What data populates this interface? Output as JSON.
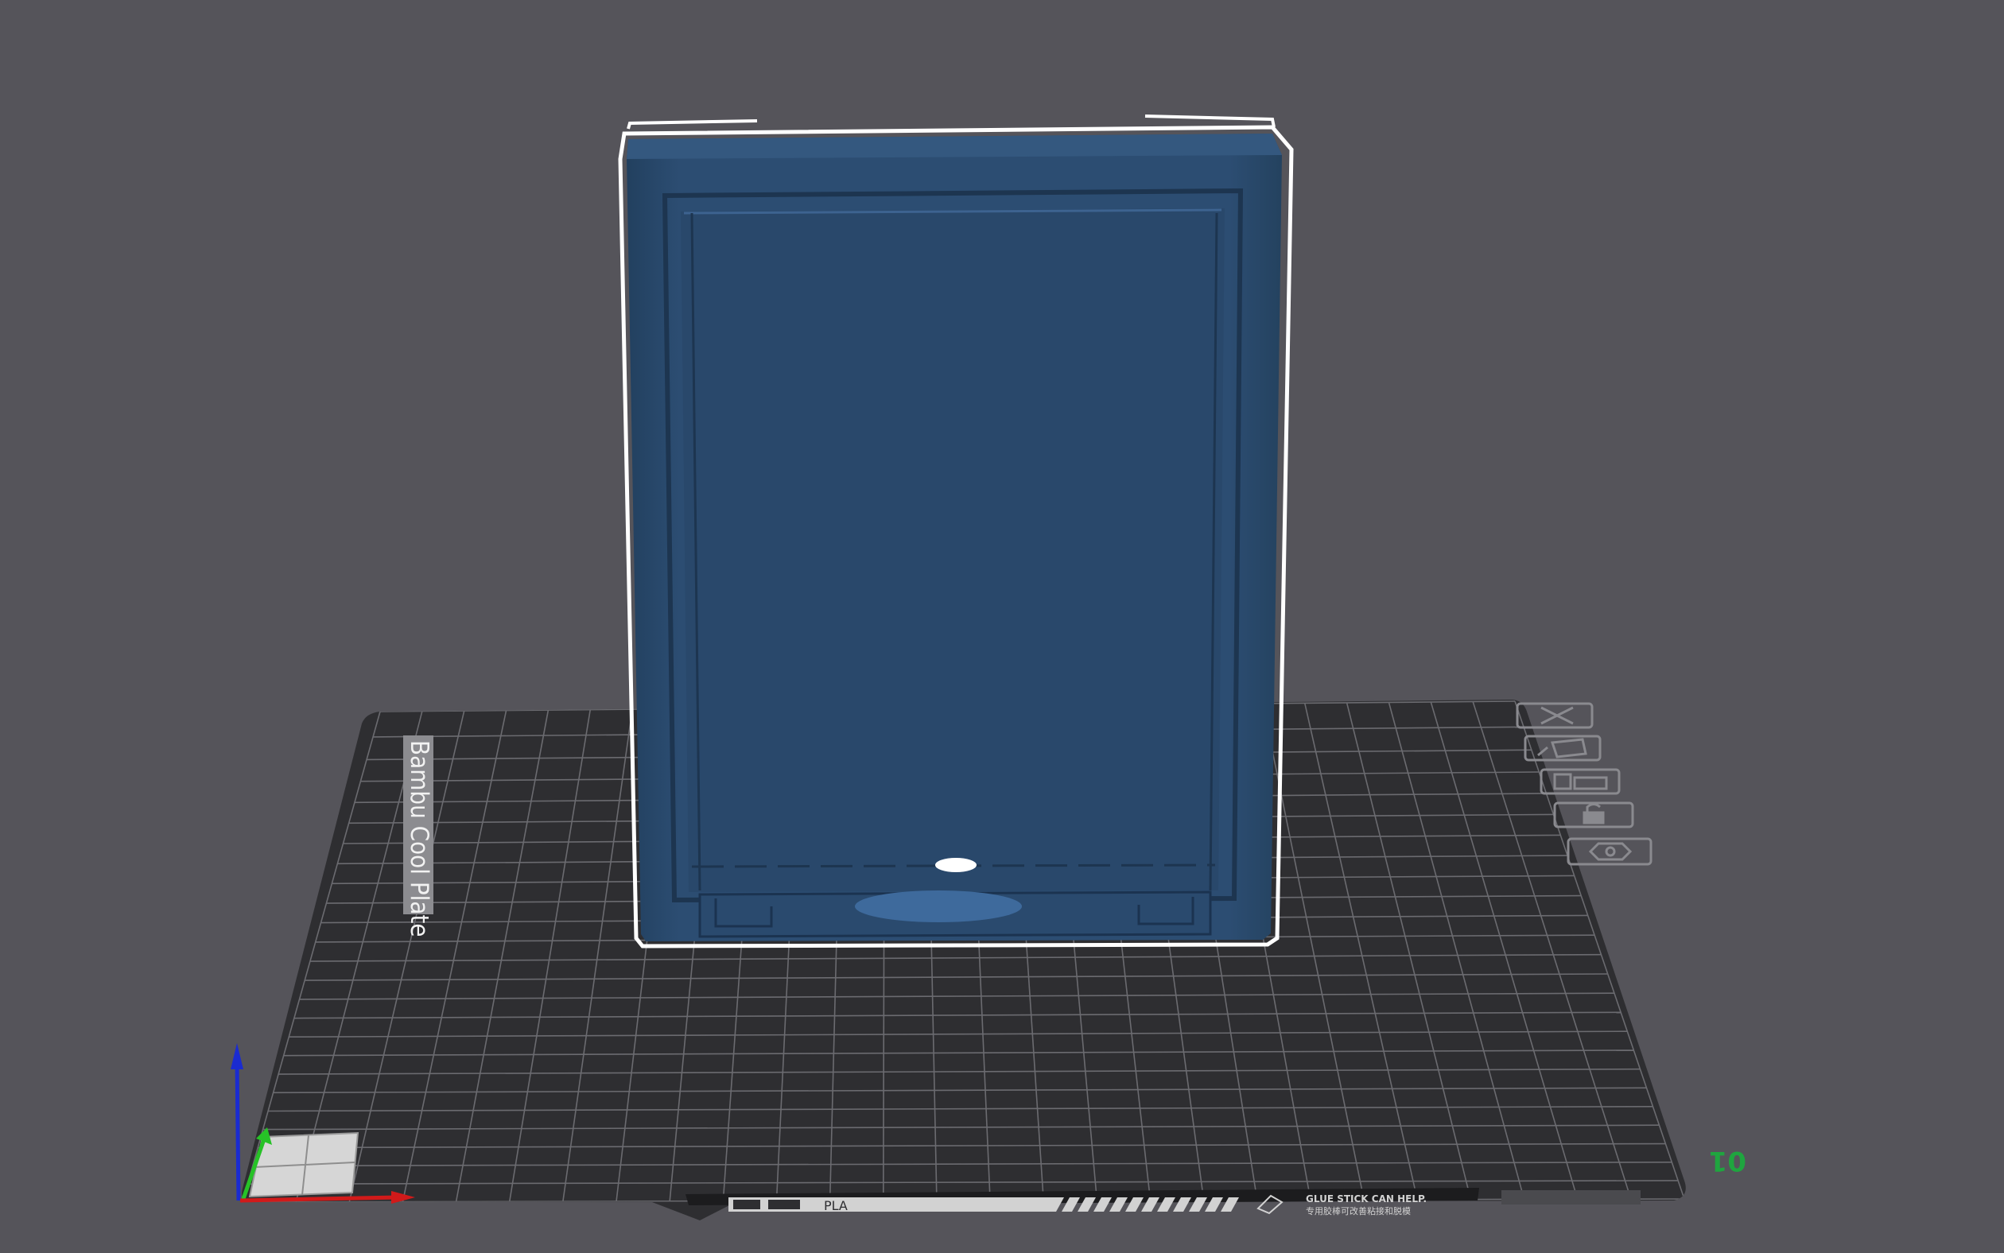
{
  "viewport": {
    "background_color": "#55545a",
    "selection_outline_color": "#ffffff"
  },
  "plate": {
    "brand_label": "Bambu Cool Plate",
    "filament_tag": "PLA",
    "notice_en": "GLUE STICK CAN HELP.",
    "notice_zh": "专用胶棒可改善粘接和脱模",
    "plate_number": "01",
    "surface_color": "#2e2e31",
    "grid_color": "#6b6b70",
    "number_color": "#1fa53f",
    "corner_icons": [
      "close-icon",
      "orient-icon",
      "arrange-icon",
      "lock-icon",
      "settings-icon"
    ]
  },
  "model": {
    "color": "#2b4b70",
    "selected": true
  },
  "axes": {
    "x_color": "#d11a1a",
    "y_color": "#27c227",
    "z_color": "#1a2bd1"
  }
}
